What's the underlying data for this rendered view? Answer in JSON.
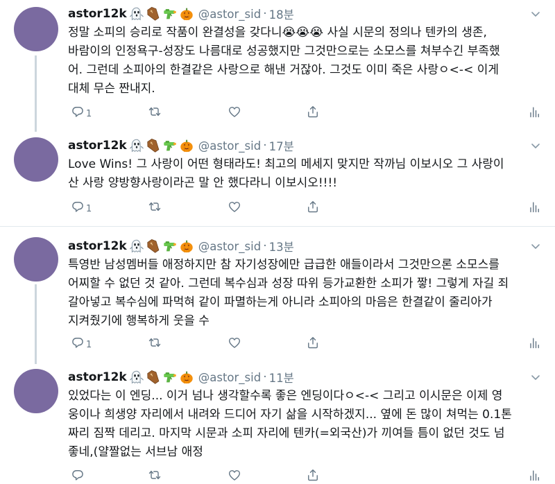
{
  "tweets": [
    {
      "name": "astor12k",
      "handle": "@astor_sid",
      "time": "18분",
      "lines": [
        "정말 소피의 승리로 작품이 완결성을 갖다니😭😭😭 사실 시문의 정의나 텐카의 생존,",
        "바람이의 인정욕구-성장도 나름대로 성공했지만 그것만으로는 소모스를 쳐부수긴 부족했",
        "어. 그런데 소피아의 한결같은 사랑으로 해낸 거잖아. 그것도 이미 죽은 사랑ㅇ<-< 이게",
        "대체 무슨 짠내지."
      ],
      "reply_count": "1"
    },
    {
      "name": "astor12k",
      "handle": "@astor_sid",
      "time": "17분",
      "lines": [
        "Love Wins! 그 사랑이 어떤 형태라도! 최고의 메세지 맞지만 작까님 이보시오 그 사랑이",
        "산 사랑 양방향사랑이라곤 말 안 했다라니 이보시오!!!!"
      ],
      "reply_count": "1"
    },
    {
      "name": "astor12k",
      "handle": "@astor_sid",
      "time": "13분",
      "lines": [
        "특영반 남성멤버들 애정하지만 참 자기성장에만 급급한 애들이라서 그것만으론 소모스를",
        "어찌할 수 없던 것 같아. 그런데 복수심과 성장 따위 등가교환한 소피가 짷! 그렇게 자길 죄",
        "갈아넣고 복수심에 파먹혀 같이 파멸하는게 아니라 소피아의 마음은 한결같이 줄리아가",
        "지켜줬기에 행복하게 웃을 수"
      ],
      "reply_count": "1"
    },
    {
      "name": "astor12k",
      "handle": "@astor_sid",
      "time": "11분",
      "lines": [
        "있었다는 이 엔딩... 이거 넘나 생각할수록 좋은 엔딩이다ㅇ<-< 그리고 이시문은 이제 영",
        "웅이나 희생양 자리에서 내려와 드디어 자기 삶을 시작하겠지... 옆에 돈 많이 쳐먹는 0.1톤",
        "짜리 짐짝 데리고. 마지막 시문과 소피 자리에 텐카(=외국산)가 끼여들 틈이 없던 것도 넘",
        "좋네,(얄짤없는 서브남 애정"
      ],
      "reply_count": ""
    }
  ],
  "separator": "·",
  "colors": {
    "avatar": "#7a6aa0",
    "text": "#14171a",
    "muted": "#657786",
    "divider": "#e1e8ed",
    "thread_line": "#ccd6dd"
  },
  "icons": [
    "ghost-emoji",
    "coffin-emoji",
    "water-pistol-emoji",
    "jack-o-lantern-emoji",
    "chevron-down-icon",
    "reply-icon",
    "retweet-icon",
    "like-icon",
    "share-icon",
    "analytics-icon"
  ]
}
